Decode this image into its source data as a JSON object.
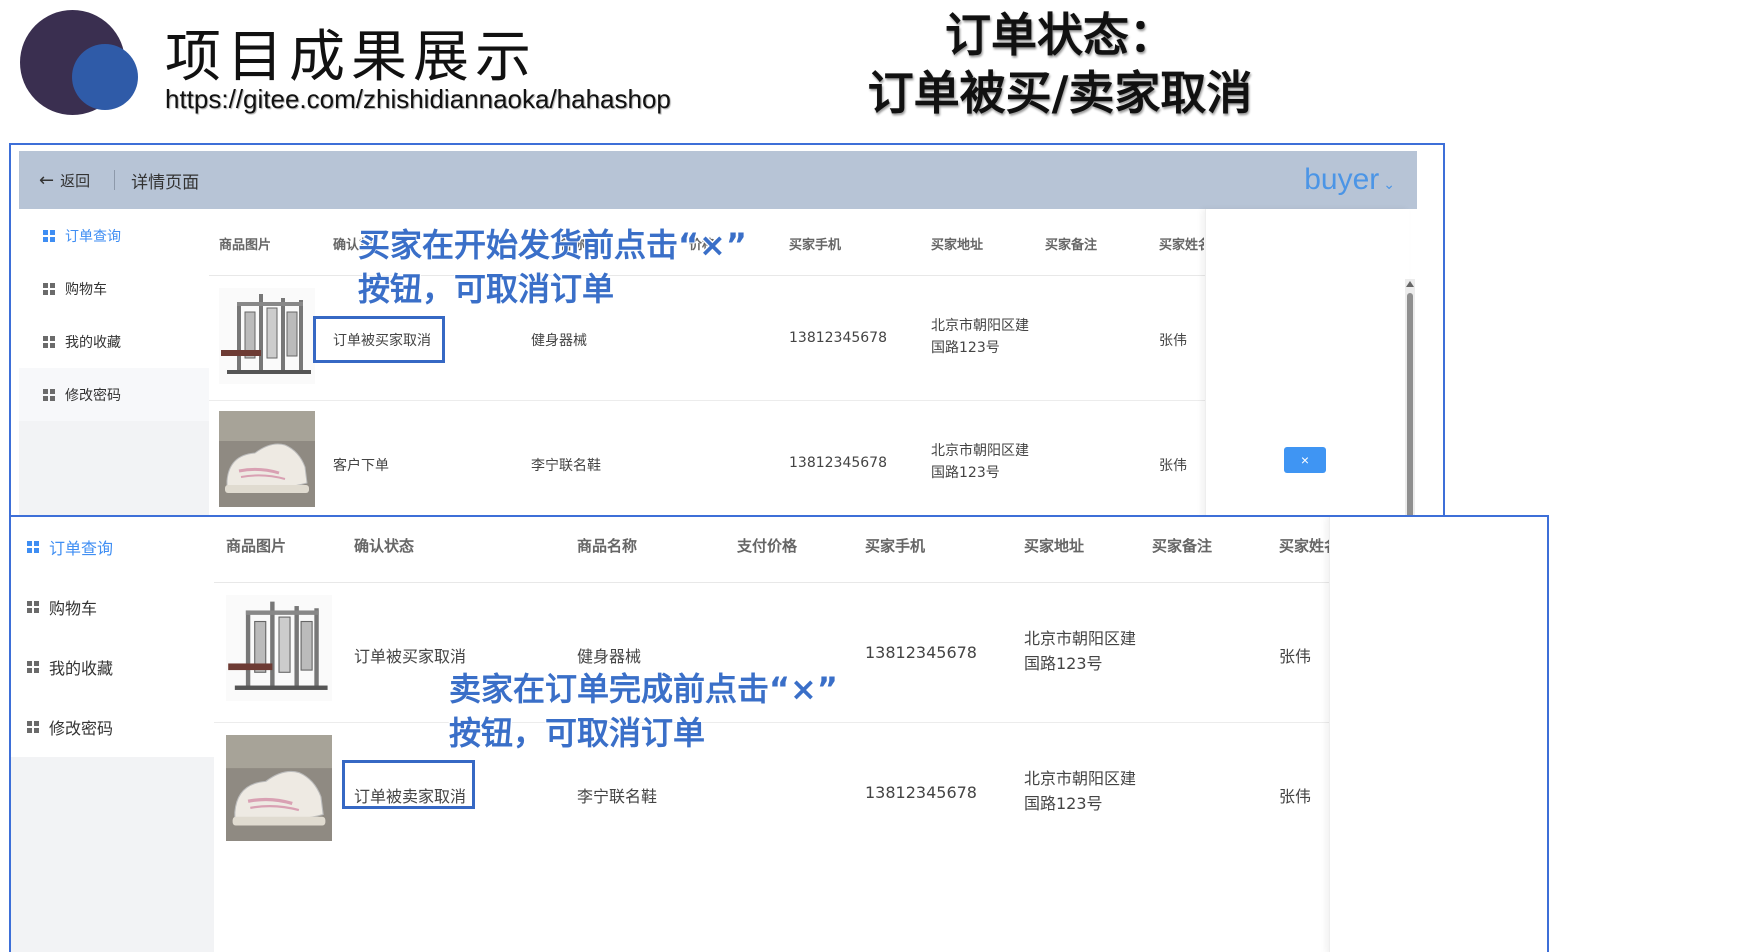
{
  "slide": {
    "title": "项目成果展示",
    "url": "https://gitee.com/zhishidiannaoka/hahashop",
    "status_heading_line1": "订单状态：",
    "status_heading_line2": "订单被买/卖家取消"
  },
  "app": {
    "back_label": "返回",
    "page_name": "详情页面",
    "user_menu": "buyer"
  },
  "sidebar": {
    "items": [
      {
        "label": "订单查询",
        "active": true
      },
      {
        "label": "购物车",
        "active": false
      },
      {
        "label": "我的收藏",
        "active": false
      },
      {
        "label": "修改密码",
        "active": false
      }
    ]
  },
  "table": {
    "headers": [
      "商品图片",
      "确认状态",
      "商品名称",
      "支付价格",
      "买家手机",
      "买家地址",
      "买家备注",
      "买家姓名"
    ],
    "header_visible": {
      "h2_partial": "确认状",
      "h3_partial": "名称",
      "h4_partial": "价格",
      "h8_partial": "买家姓名"
    }
  },
  "top_screenshot": {
    "rows": [
      {
        "product_image": "fitness-machine",
        "status": "订单被买家取消",
        "name": "健身器械",
        "phone": "13812345678",
        "address_line1": "北京市朝阳区建",
        "address_line2": "国路123号",
        "buyer_name": "张伟",
        "cancel_button": ""
      },
      {
        "product_image": "sneaker",
        "status": "客户下单",
        "name": "李宁联名鞋",
        "phone": "13812345678",
        "address_line1": "北京市朝阳区建",
        "address_line2": "国路123号",
        "buyer_name": "张伟",
        "cancel_button": "×"
      }
    ],
    "annotation_line1": "买家在开始发货前点击“×”",
    "annotation_line2": "按钮，可取消订单"
  },
  "bottom_screenshot": {
    "rows": [
      {
        "product_image": "fitness-machine",
        "status": "订单被买家取消",
        "name": "健身器械",
        "phone": "13812345678",
        "address_line1": "北京市朝阳区建",
        "address_line2": "国路123号",
        "buyer_name": "张伟"
      },
      {
        "product_image": "sneaker",
        "status": "订单被卖家取消",
        "name": "李宁联名鞋",
        "phone": "13812345678",
        "address_line1": "北京市朝阳区建",
        "address_line2": "国路123号",
        "buyer_name": "张伟"
      }
    ],
    "annotation_line1": "卖家在订单完成前点击“×”",
    "annotation_line2": "按钮，可取消订单"
  },
  "colors": {
    "frame_border": "#3d6fd8",
    "topbar": "#b7c4d6",
    "accent": "#3f8ef3",
    "annotation": "#3a6fc8",
    "logo_dark": "#3a2f50",
    "logo_blue": "#2f5ba8"
  }
}
